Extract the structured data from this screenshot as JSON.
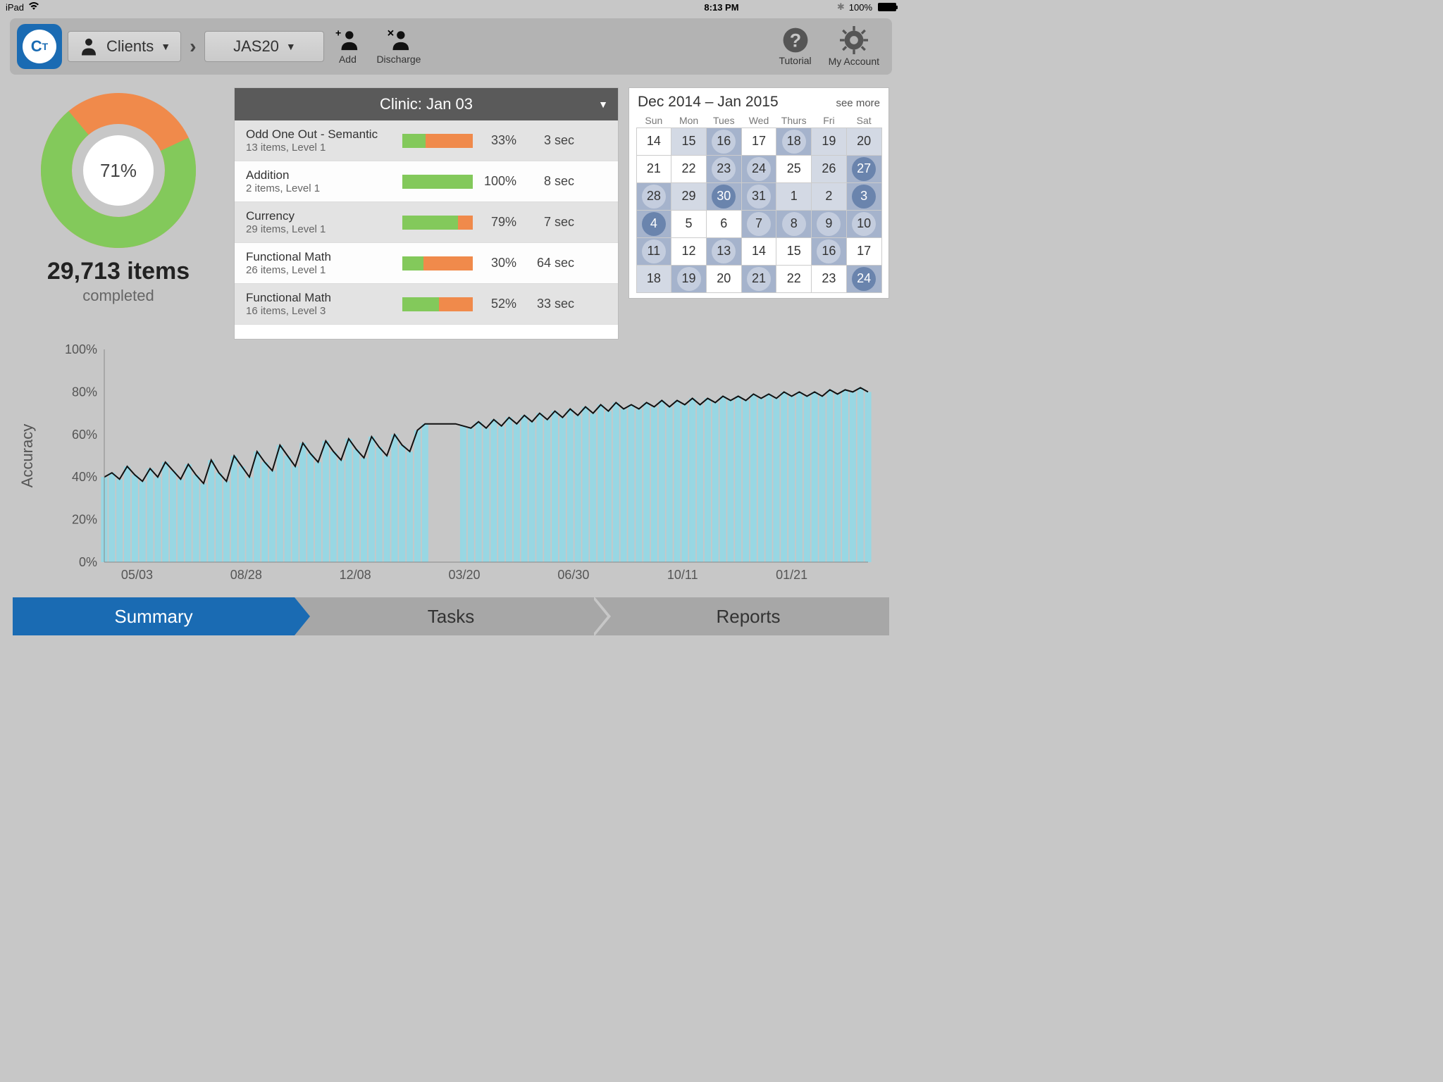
{
  "status": {
    "device": "iPad",
    "time": "8:13 PM",
    "battery": "100%"
  },
  "toolbar": {
    "clients_label": "Clients",
    "client_selected": "JAS20",
    "add_label": "Add",
    "discharge_label": "Discharge",
    "tutorial_label": "Tutorial",
    "account_label": "My Account"
  },
  "donut": {
    "percent_label": "71%",
    "percent": 71,
    "items_label": "29,713 items",
    "completed_label": "completed"
  },
  "task_header": "Clinic: Jan 03",
  "tasks": [
    {
      "name": "Odd One Out - Semantic",
      "meta": "13 items, Level 1",
      "pct": 33,
      "pct_label": "33%",
      "time": "3 sec"
    },
    {
      "name": "Addition",
      "meta": "2 items, Level 1",
      "pct": 100,
      "pct_label": "100%",
      "time": "8 sec"
    },
    {
      "name": "Currency",
      "meta": "29 items, Level 1",
      "pct": 79,
      "pct_label": "79%",
      "time": "7 sec"
    },
    {
      "name": "Functional Math",
      "meta": "26 items, Level 1",
      "pct": 30,
      "pct_label": "30%",
      "time": "64 sec"
    },
    {
      "name": "Functional Math",
      "meta": "16 items, Level 3",
      "pct": 52,
      "pct_label": "52%",
      "time": "33 sec"
    }
  ],
  "calendar": {
    "title": "Dec 2014 – Jan 2015",
    "more": "see more",
    "dow": [
      "Sun",
      "Mon",
      "Tues",
      "Wed",
      "Thurs",
      "Fri",
      "Sat"
    ],
    "cells": [
      {
        "d": "14",
        "s": 0,
        "c": 0
      },
      {
        "d": "15",
        "s": 1,
        "c": 0
      },
      {
        "d": "16",
        "s": 2,
        "c": 1
      },
      {
        "d": "17",
        "s": 0,
        "c": 0
      },
      {
        "d": "18",
        "s": 2,
        "c": 1
      },
      {
        "d": "19",
        "s": 1,
        "c": 0
      },
      {
        "d": "20",
        "s": 1,
        "c": 0
      },
      {
        "d": "21",
        "s": 0,
        "c": 0
      },
      {
        "d": "22",
        "s": 0,
        "c": 0
      },
      {
        "d": "23",
        "s": 2,
        "c": 1
      },
      {
        "d": "24",
        "s": 2,
        "c": 1
      },
      {
        "d": "25",
        "s": 0,
        "c": 0
      },
      {
        "d": "26",
        "s": 1,
        "c": 0
      },
      {
        "d": "27",
        "s": 2,
        "c": 2
      },
      {
        "d": "28",
        "s": 2,
        "c": 1
      },
      {
        "d": "29",
        "s": 1,
        "c": 0
      },
      {
        "d": "30",
        "s": 2,
        "c": 2
      },
      {
        "d": "31",
        "s": 2,
        "c": 1
      },
      {
        "d": "1",
        "s": 1,
        "c": 0
      },
      {
        "d": "2",
        "s": 1,
        "c": 0
      },
      {
        "d": "3",
        "s": 2,
        "c": 2
      },
      {
        "d": "4",
        "s": 2,
        "c": 2
      },
      {
        "d": "5",
        "s": 0,
        "c": 0
      },
      {
        "d": "6",
        "s": 0,
        "c": 0
      },
      {
        "d": "7",
        "s": 2,
        "c": 1
      },
      {
        "d": "8",
        "s": 2,
        "c": 1
      },
      {
        "d": "9",
        "s": 2,
        "c": 1
      },
      {
        "d": "10",
        "s": 2,
        "c": 1
      },
      {
        "d": "11",
        "s": 2,
        "c": 1
      },
      {
        "d": "12",
        "s": 0,
        "c": 0
      },
      {
        "d": "13",
        "s": 2,
        "c": 1
      },
      {
        "d": "14",
        "s": 0,
        "c": 0
      },
      {
        "d": "15",
        "s": 0,
        "c": 0
      },
      {
        "d": "16",
        "s": 2,
        "c": 1
      },
      {
        "d": "17",
        "s": 0,
        "c": 0
      },
      {
        "d": "18",
        "s": 1,
        "c": 0
      },
      {
        "d": "19",
        "s": 2,
        "c": 1
      },
      {
        "d": "20",
        "s": 0,
        "c": 0
      },
      {
        "d": "21",
        "s": 2,
        "c": 1
      },
      {
        "d": "22",
        "s": 0,
        "c": 0
      },
      {
        "d": "23",
        "s": 0,
        "c": 0
      },
      {
        "d": "24",
        "s": 2,
        "c": 2
      }
    ]
  },
  "tabs": {
    "summary": "Summary",
    "tasks": "Tasks",
    "reports": "Reports"
  },
  "chart_data": {
    "type": "line",
    "title": "",
    "xlabel": "",
    "ylabel": "Accuracy",
    "ylim": [
      0,
      100
    ],
    "y_ticks": [
      "0%",
      "20%",
      "40%",
      "60%",
      "80%",
      "100%"
    ],
    "x_ticks": [
      "05/03",
      "08/28",
      "12/08",
      "03/20",
      "06/30",
      "10/11",
      "01/21"
    ],
    "x": [
      0,
      0.01,
      0.02,
      0.03,
      0.04,
      0.05,
      0.06,
      0.07,
      0.08,
      0.09,
      0.1,
      0.11,
      0.12,
      0.13,
      0.14,
      0.15,
      0.16,
      0.17,
      0.18,
      0.19,
      0.2,
      0.21,
      0.22,
      0.23,
      0.24,
      0.25,
      0.26,
      0.27,
      0.28,
      0.29,
      0.3,
      0.31,
      0.32,
      0.33,
      0.34,
      0.35,
      0.36,
      0.37,
      0.38,
      0.39,
      0.4,
      0.41,
      0.42,
      0.43,
      0.44,
      0.45,
      0.46,
      0.47,
      0.48,
      0.49,
      0.5,
      0.51,
      0.52,
      0.53,
      0.54,
      0.55,
      0.56,
      0.57,
      0.58,
      0.59,
      0.6,
      0.61,
      0.62,
      0.63,
      0.64,
      0.65,
      0.66,
      0.67,
      0.68,
      0.69,
      0.7,
      0.71,
      0.72,
      0.73,
      0.74,
      0.75,
      0.76,
      0.77,
      0.78,
      0.79,
      0.8,
      0.81,
      0.82,
      0.83,
      0.84,
      0.85,
      0.86,
      0.87,
      0.88,
      0.89,
      0.9,
      0.91,
      0.92,
      0.93,
      0.94,
      0.95,
      0.96,
      0.97,
      0.98,
      0.99,
      1.0
    ],
    "y": [
      40,
      42,
      39,
      45,
      41,
      38,
      44,
      40,
      47,
      43,
      39,
      46,
      41,
      37,
      48,
      42,
      38,
      50,
      45,
      40,
      52,
      47,
      43,
      55,
      50,
      45,
      56,
      51,
      47,
      57,
      52,
      48,
      58,
      53,
      49,
      59,
      54,
      50,
      60,
      55,
      52,
      62,
      65,
      65,
      65,
      65,
      65,
      64,
      63,
      66,
      63,
      67,
      64,
      68,
      65,
      69,
      66,
      70,
      67,
      71,
      68,
      72,
      69,
      73,
      70,
      74,
      71,
      75,
      72,
      74,
      72,
      75,
      73,
      76,
      73,
      76,
      74,
      77,
      74,
      77,
      75,
      78,
      76,
      78,
      76,
      79,
      77,
      79,
      77,
      80,
      78,
      80,
      78,
      80,
      78,
      81,
      79,
      81,
      80,
      82,
      80
    ]
  }
}
